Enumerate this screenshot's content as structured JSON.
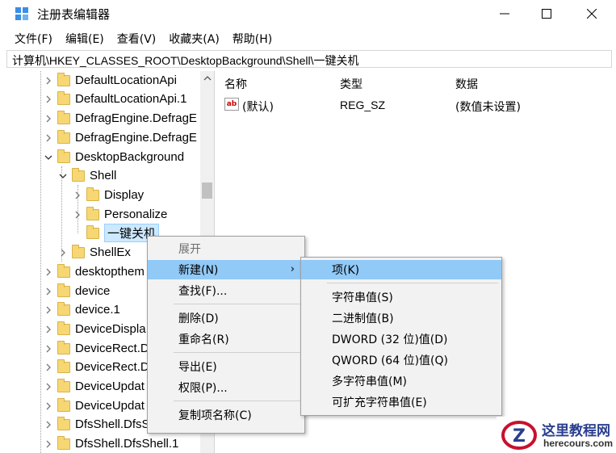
{
  "window": {
    "title": "注册表编辑器",
    "icon": "regedit-icon"
  },
  "menu": [
    "文件(F)",
    "编辑(E)",
    "查看(V)",
    "收藏夹(A)",
    "帮助(H)"
  ],
  "address": "计算机\\HKEY_CLASSES_ROOT\\DesktopBackground\\Shell\\一键关机",
  "tree": [
    {
      "label": "DefaultLocationApi",
      "expander": "collapsed"
    },
    {
      "label": "DefaultLocationApi.1",
      "expander": "collapsed"
    },
    {
      "label": "DefragEngine.DefragE",
      "expander": "collapsed"
    },
    {
      "label": "DefragEngine.DefragE",
      "expander": "collapsed"
    },
    {
      "label": "DesktopBackground",
      "expander": "expanded"
    },
    {
      "label": "Shell",
      "expander": "expanded"
    },
    {
      "label": "Display",
      "expander": "collapsed"
    },
    {
      "label": "Personalize",
      "expander": "collapsed"
    },
    {
      "label": "一键关机",
      "expander": "none"
    },
    {
      "label": "ShellEx",
      "expander": "collapsed"
    },
    {
      "label": "desktopthem",
      "expander": "collapsed"
    },
    {
      "label": "device",
      "expander": "collapsed"
    },
    {
      "label": "device.1",
      "expander": "collapsed"
    },
    {
      "label": "DeviceDispla",
      "expander": "collapsed"
    },
    {
      "label": "DeviceRect.D",
      "expander": "collapsed"
    },
    {
      "label": "DeviceRect.D",
      "expander": "collapsed"
    },
    {
      "label": "DeviceUpdat",
      "expander": "collapsed"
    },
    {
      "label": "DeviceUpdat",
      "expander": "collapsed"
    },
    {
      "label": "DfsShell.DfsS",
      "expander": "collapsed"
    },
    {
      "label": "DfsShell.DfsShell.1",
      "expander": "collapsed"
    }
  ],
  "values_pane": {
    "columns": [
      "名称",
      "类型",
      "数据"
    ],
    "rows": [
      {
        "name": "(默认)",
        "type": "REG_SZ",
        "data": "(数值未设置)",
        "icon": "string-value-icon"
      }
    ]
  },
  "context_menu": {
    "items": [
      "展开",
      "新建(N)",
      "查找(F)...",
      "删除(D)",
      "重命名(R)",
      "导出(E)",
      "权限(P)...",
      "复制项名称(C)"
    ]
  },
  "submenu": {
    "items": [
      "项(K)",
      "字符串值(S)",
      "二进制值(B)",
      "DWORD (32 位)值(D)",
      "QWORD (64 位)值(Q)",
      "多字符串值(M)",
      "可扩充字符串值(E)"
    ]
  },
  "watermark": {
    "title": "这里教程网",
    "url": "herecours.com"
  },
  "colors": {
    "hover": "#91c9f7",
    "folder": "#f6d774",
    "selected": "#cde8ff"
  }
}
